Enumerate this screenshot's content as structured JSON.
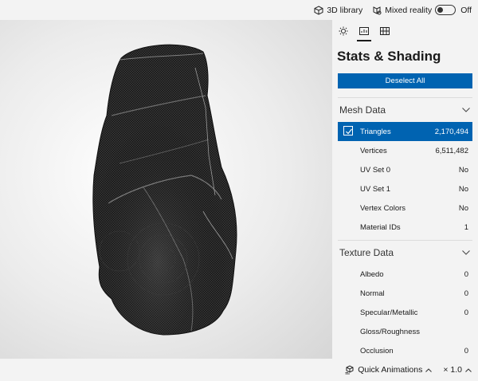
{
  "topbar": {
    "library_icon": "cube-icon",
    "library_label": "3D library",
    "mixed_icon": "mixed-reality-icon",
    "mixed_label": "Mixed reality",
    "toggle_state": "Off"
  },
  "panel": {
    "tabs": [
      {
        "icon": "sun-icon"
      },
      {
        "icon": "stats-icon",
        "active": true
      },
      {
        "icon": "grid-icon"
      }
    ],
    "title": "Stats & Shading",
    "deselect_label": "Deselect All",
    "mesh_section": {
      "label": "Mesh Data",
      "rows": [
        {
          "label": "Triangles",
          "value": "2,170,494",
          "selected": true
        },
        {
          "label": "Vertices",
          "value": "6,511,482"
        },
        {
          "label": "UV Set 0",
          "value": "No"
        },
        {
          "label": "UV Set 1",
          "value": "No"
        },
        {
          "label": "Vertex Colors",
          "value": "No"
        },
        {
          "label": "Material IDs",
          "value": "1"
        }
      ]
    },
    "texture_section": {
      "label": "Texture Data",
      "rows": [
        {
          "label": "Albedo",
          "value": "0"
        },
        {
          "label": "Normal",
          "value": "0"
        },
        {
          "label": "Specular/Metallic",
          "value": "0"
        },
        {
          "label": "Gloss/Roughness",
          "value": ""
        },
        {
          "label": "Occlusion",
          "value": "0"
        }
      ]
    }
  },
  "bottombar": {
    "anim_icon": "animation-icon",
    "anim_label": "Quick Animations",
    "speed_label": "× 1.0"
  },
  "colors": {
    "accent": "#0063b1",
    "background": "#f3f3f3"
  }
}
